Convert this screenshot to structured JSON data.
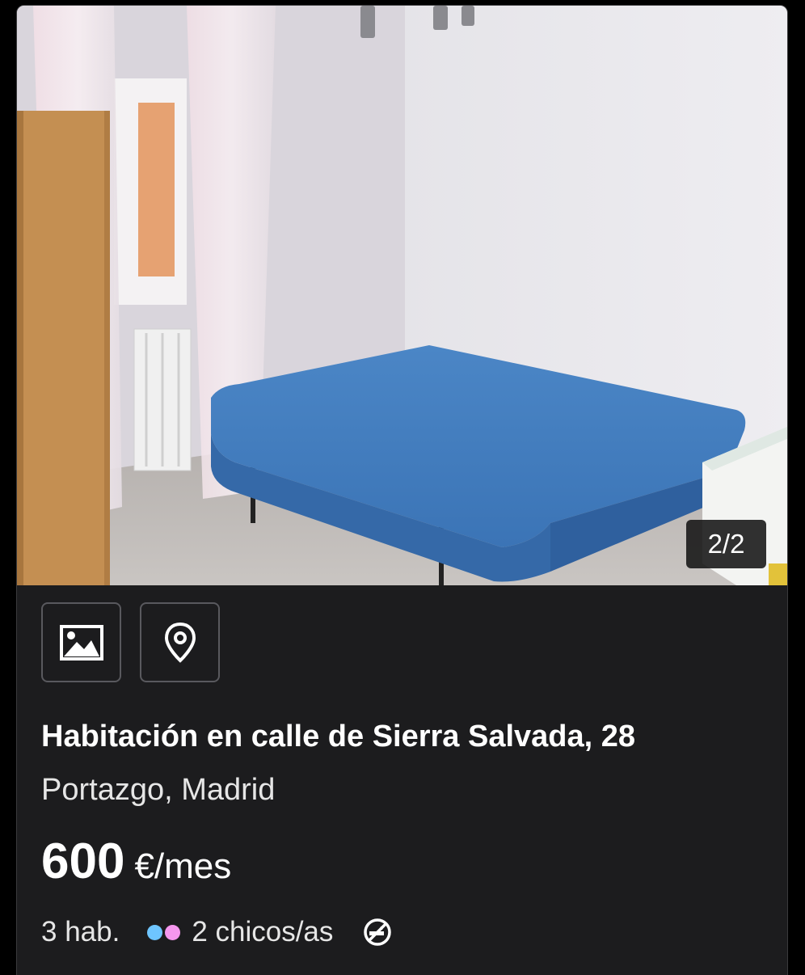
{
  "listing": {
    "photo_counter": "2/2",
    "title": "Habitación en calle de Sierra Salvada, 28",
    "location": "Portazgo, Madrid",
    "price_value": "600",
    "price_unit": "€/mes",
    "rooms": "3 hab.",
    "flatmates": "2 chicos/as",
    "icons": {
      "gallery": "image-icon",
      "map": "location-pin-icon",
      "gender": "gender-mix-dots-icon",
      "smoking": "no-smoking-icon"
    }
  },
  "colors": {
    "card_background": "#1c1c1e",
    "button_border": "#59595e",
    "text_primary": "#ffffff",
    "dot_blue": "#6ec5ff",
    "dot_pink": "#f597ee"
  }
}
